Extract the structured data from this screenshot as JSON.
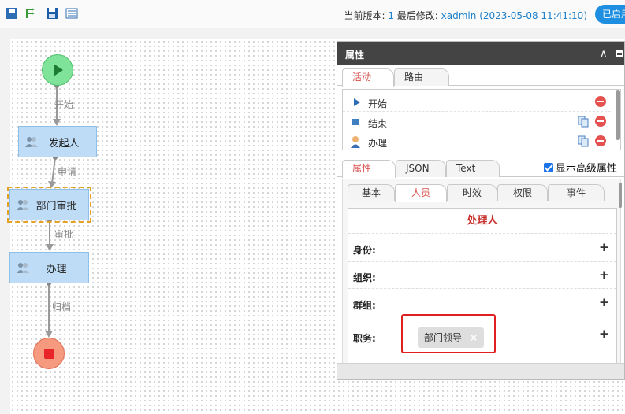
{
  "toolbar": {
    "version_label": "当前版本:",
    "version_value": "1",
    "modified_label": "最后修改:",
    "modified_value": "xadmin (2023-05-08 11:41:10)",
    "publish_label": "已启用"
  },
  "flow": {
    "start_label": "开始",
    "node1": "发起人",
    "edge2": "申请",
    "node2": "部门审批",
    "edge3": "审批",
    "node3": "办理",
    "edge4": "归档"
  },
  "panel": {
    "title": "属性",
    "top_tabs": [
      "活动",
      "路由"
    ],
    "activities": [
      {
        "label": "开始",
        "icon": "play-icon"
      },
      {
        "label": "结束",
        "icon": "stop-square-icon"
      },
      {
        "label": "办理",
        "icon": "user-icon"
      }
    ],
    "prop_tabs": [
      "属性",
      "JSON",
      "Text"
    ],
    "advanced_label": "显示高级属性",
    "advanced_checked": true,
    "sub_tabs": [
      "基本",
      "人员",
      "时效",
      "权限",
      "事件"
    ],
    "handler_title": "处理人",
    "handler_rows": [
      "身份:",
      "组织:",
      "群组:",
      "职务:"
    ],
    "role_tag": "部门领导",
    "tag_remove": "×",
    "add_symbol": "+"
  },
  "colors": {
    "accent_red": "#d9534f",
    "link_blue": "#1a7fc9",
    "node_blue": "#bfdcf7",
    "start_green": "#7fe39a",
    "end_red": "#f59a7e"
  }
}
